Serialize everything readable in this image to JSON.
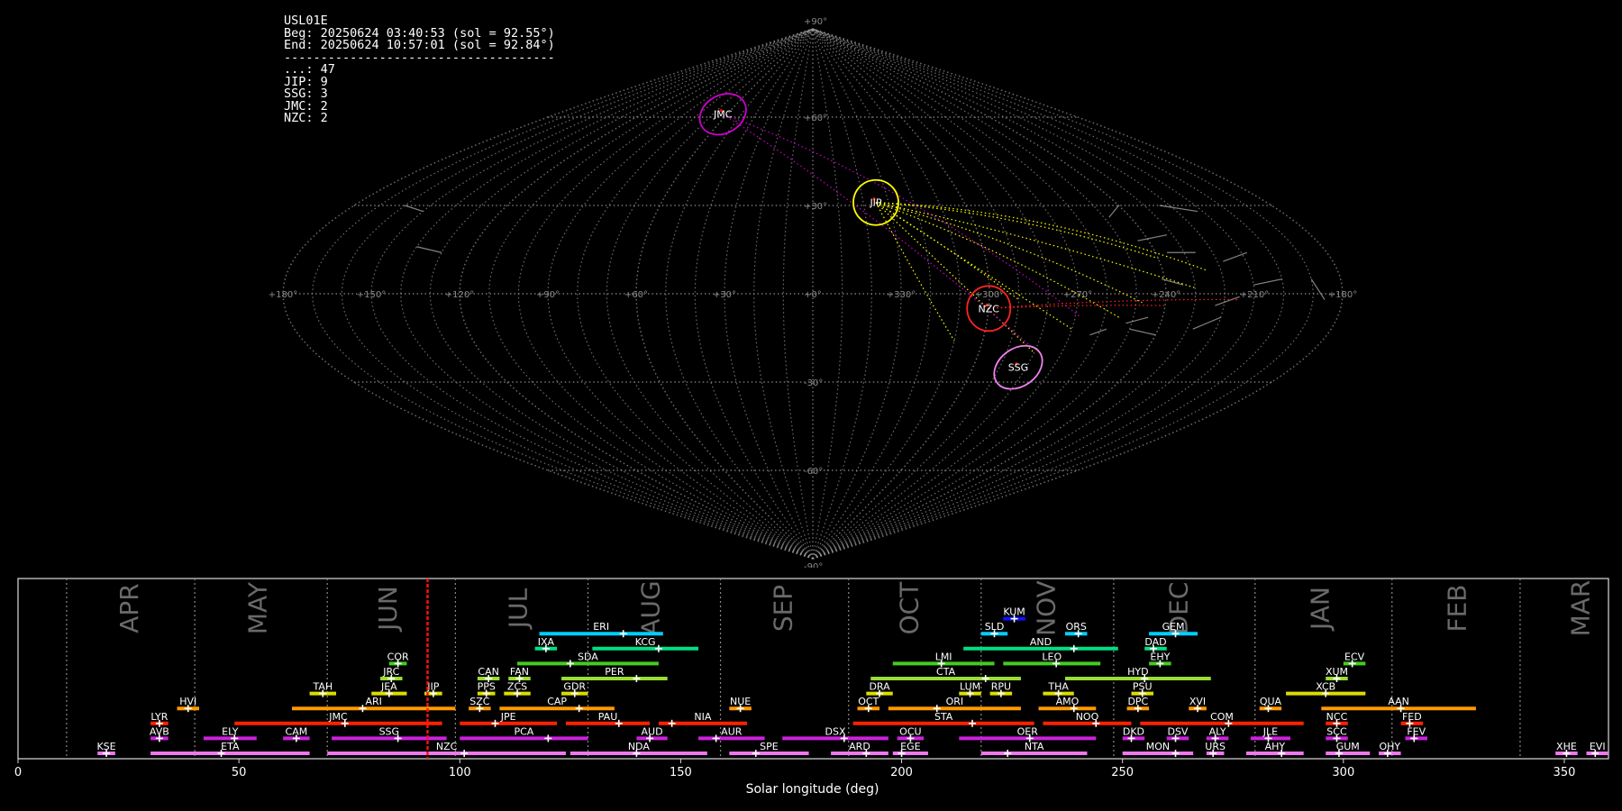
{
  "summary": {
    "station": "USL01E",
    "begin": "Beg: 20250624 03:40:53 (sol = 92.55°)",
    "end": "End: 20250624 10:57:01 (sol = 92.84°)",
    "separator": "-------------------------------------",
    "counts": [
      {
        "code": "...",
        "n": 47,
        "text": "...: 47"
      },
      {
        "code": "JIP",
        "n": 9,
        "text": "JIP: 9"
      },
      {
        "code": "SSG",
        "n": 3,
        "text": "SSG: 3"
      },
      {
        "code": "JMC",
        "n": 2,
        "text": "JMC: 2"
      },
      {
        "code": "NZC",
        "n": 2,
        "text": "NZC: 2"
      }
    ]
  },
  "colors": {
    "background": "#000000",
    "grid": "#9a9a9a",
    "sporadic": "#bbbbbb",
    "solar_marker": "#ff0000",
    "JIP": "#ffff00",
    "SSG": "#ee82ee",
    "JMC": "#cc00cc",
    "NZC": "#ff2222"
  },
  "chart_data": [
    {
      "type": "scatter",
      "projection": "sinusoidal",
      "lon_ticks": [
        "+180°",
        "+150°",
        "+120°",
        "+90°",
        "+60°",
        "+30°",
        "+0°",
        "+330°",
        "+300°",
        "+270°",
        "+240°",
        "+210°",
        "+180°"
      ],
      "lat_ticks": [
        "+90°",
        "+60°",
        "+30°",
        "-30°",
        "-60°",
        "-90°"
      ],
      "radiants": [
        {
          "code": "JMC",
          "lon": 63,
          "lat": 61,
          "color": "#cc00cc"
        },
        {
          "code": "JIP",
          "lon": 335,
          "lat": 31,
          "color": "#ffff00"
        },
        {
          "code": "NZC",
          "lon": 300,
          "lat": -5,
          "color": "#ff2222"
        },
        {
          "code": "SSG",
          "lon": 283,
          "lat": -25,
          "color": "#ee82ee"
        }
      ]
    },
    {
      "type": "timeline",
      "xlabel": "Solar longitude (deg)",
      "xlim": [
        0,
        360
      ],
      "xticks": [
        0,
        50,
        100,
        150,
        200,
        250,
        300,
        350
      ],
      "current_sol": 92.7,
      "months": [
        {
          "name": "APR",
          "start": 11,
          "label_at": 24.5
        },
        {
          "name": "MAY",
          "start": 40,
          "label_at": 53.5
        },
        {
          "name": "JUN",
          "start": 70,
          "label_at": 83
        },
        {
          "name": "JUL",
          "start": 99,
          "label_at": 112.5
        },
        {
          "name": "AUG",
          "start": 129,
          "label_at": 142.5
        },
        {
          "name": "SEP",
          "start": 159,
          "label_at": 172.5
        },
        {
          "name": "OCT",
          "start": 188,
          "label_at": 201
        },
        {
          "name": "NOV",
          "start": 218,
          "label_at": 232
        },
        {
          "name": "DEC",
          "start": 248,
          "label_at": 262
        },
        {
          "name": "JAN",
          "start": 280,
          "label_at": 294
        },
        {
          "name": "FEB",
          "start": 311,
          "label_at": 325
        },
        {
          "name": "MAR",
          "start": 340,
          "label_at": 353
        }
      ],
      "showers": [
        {
          "code": "KUM",
          "start": 223,
          "end": 228,
          "peak": 225.5,
          "row": 10,
          "color": "#1111ff"
        },
        {
          "code": "ERI",
          "start": 118,
          "end": 146,
          "peak": 137,
          "row": 9,
          "color": "#00cfff"
        },
        {
          "code": "SLD",
          "start": 218,
          "end": 224,
          "peak": 221,
          "row": 9,
          "color": "#00cfff"
        },
        {
          "code": "ORS",
          "start": 237,
          "end": 242,
          "peak": 240,
          "row": 9,
          "color": "#00cfff"
        },
        {
          "code": "GEM",
          "start": 256,
          "end": 267,
          "peak": 262,
          "row": 9,
          "color": "#00cfff"
        },
        {
          "code": "IXA",
          "start": 117,
          "end": 122,
          "peak": 119.5,
          "row": 8,
          "color": "#00e080"
        },
        {
          "code": "KCG",
          "start": 130,
          "end": 154,
          "peak": 145,
          "row": 8,
          "color": "#00e080"
        },
        {
          "code": "AND",
          "start": 214,
          "end": 249,
          "peak": 239,
          "row": 8,
          "color": "#00e080"
        },
        {
          "code": "DAD",
          "start": 255,
          "end": 260,
          "peak": 257,
          "row": 8,
          "color": "#00e080"
        },
        {
          "code": "COR",
          "start": 84,
          "end": 88,
          "peak": 86,
          "row": 7,
          "color": "#44cc22"
        },
        {
          "code": "SDA",
          "start": 113,
          "end": 145,
          "peak": 125,
          "row": 7,
          "color": "#44cc22"
        },
        {
          "code": "LMI",
          "start": 198,
          "end": 221,
          "peak": 209,
          "row": 7,
          "color": "#44cc22"
        },
        {
          "code": "LEO",
          "start": 223,
          "end": 245,
          "peak": 235,
          "row": 7,
          "color": "#44cc22"
        },
        {
          "code": "EHY",
          "start": 256,
          "end": 261,
          "peak": 258.5,
          "row": 7,
          "color": "#44cc22"
        },
        {
          "code": "ECV",
          "start": 300,
          "end": 305,
          "peak": 302,
          "row": 7,
          "color": "#44cc22"
        },
        {
          "code": "JRC",
          "start": 82,
          "end": 87,
          "peak": 84.5,
          "row": 6,
          "color": "#99dd33"
        },
        {
          "code": "CAN",
          "start": 104,
          "end": 109,
          "peak": 106.5,
          "row": 6,
          "color": "#99dd33"
        },
        {
          "code": "FAN",
          "start": 111,
          "end": 116,
          "peak": 113.5,
          "row": 6,
          "color": "#99dd33"
        },
        {
          "code": "PER",
          "start": 123,
          "end": 147,
          "peak": 140,
          "row": 6,
          "color": "#99dd33"
        },
        {
          "code": "CTA",
          "start": 193,
          "end": 227,
          "peak": 219,
          "row": 6,
          "color": "#99dd33"
        },
        {
          "code": "HYD",
          "start": 237,
          "end": 270,
          "peak": 255,
          "row": 6,
          "color": "#99dd33"
        },
        {
          "code": "XUM",
          "start": 296,
          "end": 301,
          "peak": 298.5,
          "row": 6,
          "color": "#99dd33"
        },
        {
          "code": "TAH",
          "start": 66,
          "end": 72,
          "peak": 69,
          "row": 5,
          "color": "#dddd00"
        },
        {
          "code": "JEA",
          "start": 80,
          "end": 88,
          "peak": 84,
          "row": 5,
          "color": "#dddd00"
        },
        {
          "code": "JIP",
          "start": 92,
          "end": 96,
          "peak": 94,
          "row": 5,
          "color": "#dddd00"
        },
        {
          "code": "PPS",
          "start": 104,
          "end": 108,
          "peak": 106,
          "row": 5,
          "color": "#dddd00"
        },
        {
          "code": "ZCS",
          "start": 110,
          "end": 116,
          "peak": 113,
          "row": 5,
          "color": "#dddd00"
        },
        {
          "code": "GDR",
          "start": 123,
          "end": 129,
          "peak": 126,
          "row": 5,
          "color": "#dddd00"
        },
        {
          "code": "DRA",
          "start": 192,
          "end": 198,
          "peak": 195,
          "row": 5,
          "color": "#dddd00"
        },
        {
          "code": "LUM",
          "start": 213,
          "end": 218,
          "peak": 215.5,
          "row": 5,
          "color": "#dddd00"
        },
        {
          "code": "RPU",
          "start": 220,
          "end": 225,
          "peak": 222.5,
          "row": 5,
          "color": "#dddd00"
        },
        {
          "code": "THA",
          "start": 232,
          "end": 239,
          "peak": 235.5,
          "row": 5,
          "color": "#dddd00"
        },
        {
          "code": "PSU",
          "start": 252,
          "end": 257,
          "peak": 254.5,
          "row": 5,
          "color": "#dddd00"
        },
        {
          "code": "XCB",
          "start": 287,
          "end": 305,
          "peak": 296,
          "row": 5,
          "color": "#dddd00"
        },
        {
          "code": "HVI",
          "start": 36,
          "end": 41,
          "peak": 38.5,
          "row": 4,
          "color": "#ff9900"
        },
        {
          "code": "ARI",
          "start": 62,
          "end": 99,
          "peak": 78,
          "row": 4,
          "color": "#ff9900"
        },
        {
          "code": "SZC",
          "start": 102,
          "end": 107,
          "peak": 104.5,
          "row": 4,
          "color": "#ff9900"
        },
        {
          "code": "CAP",
          "start": 109,
          "end": 135,
          "peak": 127,
          "row": 4,
          "color": "#ff9900"
        },
        {
          "code": "NUE",
          "start": 161,
          "end": 166,
          "peak": 163.5,
          "row": 4,
          "color": "#ff9900"
        },
        {
          "code": "OCT",
          "start": 190,
          "end": 195,
          "peak": 192.5,
          "row": 4,
          "color": "#ff9900"
        },
        {
          "code": "ORI",
          "start": 197,
          "end": 227,
          "peak": 208,
          "row": 4,
          "color": "#ff9900"
        },
        {
          "code": "AMO",
          "start": 231,
          "end": 244,
          "peak": 239,
          "row": 4,
          "color": "#ff9900"
        },
        {
          "code": "DPC",
          "start": 251,
          "end": 256,
          "peak": 253.5,
          "row": 4,
          "color": "#ff9900"
        },
        {
          "code": "XVI",
          "start": 265,
          "end": 269,
          "peak": 267,
          "row": 4,
          "color": "#ff9900"
        },
        {
          "code": "QUA",
          "start": 281,
          "end": 286,
          "peak": 283,
          "row": 4,
          "color": "#ff9900"
        },
        {
          "code": "AAN",
          "start": 295,
          "end": 330,
          "peak": 313,
          "row": 4,
          "color": "#ff9900"
        },
        {
          "code": "LYR",
          "start": 30,
          "end": 34,
          "peak": 32,
          "row": 3,
          "color": "#ff2200"
        },
        {
          "code": "JMC",
          "start": 49,
          "end": 96,
          "peak": 74,
          "row": 3,
          "color": "#ff2200"
        },
        {
          "code": "JPE",
          "start": 100,
          "end": 122,
          "peak": 108,
          "row": 3,
          "color": "#ff2200"
        },
        {
          "code": "PAU",
          "start": 124,
          "end": 143,
          "peak": 136,
          "row": 3,
          "color": "#ff2200"
        },
        {
          "code": "NIA",
          "start": 145,
          "end": 165,
          "peak": 148,
          "row": 3,
          "color": "#ff2200"
        },
        {
          "code": "STA",
          "start": 189,
          "end": 230,
          "peak": 216,
          "row": 3,
          "color": "#ff2200"
        },
        {
          "code": "NOO",
          "start": 232,
          "end": 252,
          "peak": 244,
          "row": 3,
          "color": "#ff2200"
        },
        {
          "code": "COM",
          "start": 254,
          "end": 291,
          "peak": 274,
          "row": 3,
          "color": "#ff2200"
        },
        {
          "code": "NCC",
          "start": 296,
          "end": 301,
          "peak": 298.5,
          "row": 3,
          "color": "#ff2200"
        },
        {
          "code": "FED",
          "start": 313,
          "end": 318,
          "peak": 315,
          "row": 3,
          "color": "#ff2200"
        },
        {
          "code": "AVB",
          "start": 30,
          "end": 34,
          "peak": 32,
          "row": 2,
          "color": "#cc22dd"
        },
        {
          "code": "ELY",
          "start": 42,
          "end": 54,
          "peak": 49,
          "row": 2,
          "color": "#cc22dd"
        },
        {
          "code": "CAM",
          "start": 60,
          "end": 66,
          "peak": 63,
          "row": 2,
          "color": "#cc22dd"
        },
        {
          "code": "SSG",
          "start": 71,
          "end": 97,
          "peak": 86,
          "row": 2,
          "color": "#cc22dd"
        },
        {
          "code": "PCA",
          "start": 100,
          "end": 129,
          "peak": 120,
          "row": 2,
          "color": "#cc22dd"
        },
        {
          "code": "AUD",
          "start": 140,
          "end": 147,
          "peak": 143,
          "row": 2,
          "color": "#cc22dd"
        },
        {
          "code": "AUR",
          "start": 154,
          "end": 169,
          "peak": 158,
          "row": 2,
          "color": "#cc22dd"
        },
        {
          "code": "DSX",
          "start": 173,
          "end": 197,
          "peak": 187,
          "row": 2,
          "color": "#cc22dd"
        },
        {
          "code": "OCU",
          "start": 199,
          "end": 205,
          "peak": 202,
          "row": 2,
          "color": "#cc22dd"
        },
        {
          "code": "OER",
          "start": 213,
          "end": 244,
          "peak": 229,
          "row": 2,
          "color": "#cc22dd"
        },
        {
          "code": "DKD",
          "start": 250,
          "end": 255,
          "peak": 252,
          "row": 2,
          "color": "#cc22dd"
        },
        {
          "code": "DSV",
          "start": 260,
          "end": 265,
          "peak": 262,
          "row": 2,
          "color": "#cc22dd"
        },
        {
          "code": "ALY",
          "start": 269,
          "end": 274,
          "peak": 271,
          "row": 2,
          "color": "#cc22dd"
        },
        {
          "code": "JLE",
          "start": 279,
          "end": 288,
          "peak": 283,
          "row": 2,
          "color": "#cc22dd"
        },
        {
          "code": "SCC",
          "start": 296,
          "end": 301,
          "peak": 298.5,
          "row": 2,
          "color": "#cc22dd"
        },
        {
          "code": "FEV",
          "start": 314,
          "end": 319,
          "peak": 316,
          "row": 2,
          "color": "#cc22dd"
        },
        {
          "code": "KSE",
          "start": 18,
          "end": 22,
          "peak": 20,
          "row": 1,
          "color": "#ee77ee"
        },
        {
          "code": "ETA",
          "start": 30,
          "end": 66,
          "peak": 46,
          "row": 1,
          "color": "#ee77ee"
        },
        {
          "code": "NZC",
          "start": 70,
          "end": 124,
          "peak": 101,
          "row": 1,
          "color": "#ee77ee"
        },
        {
          "code": "NDA",
          "start": 125,
          "end": 156,
          "peak": 140,
          "row": 1,
          "color": "#ee77ee"
        },
        {
          "code": "SPE",
          "start": 161,
          "end": 179,
          "peak": 167,
          "row": 1,
          "color": "#ee77ee"
        },
        {
          "code": "ARD",
          "start": 184,
          "end": 197,
          "peak": 192,
          "row": 1,
          "color": "#ee77ee"
        },
        {
          "code": "EGE",
          "start": 198,
          "end": 206,
          "peak": 200,
          "row": 1,
          "color": "#ee77ee"
        },
        {
          "code": "NTA",
          "start": 218,
          "end": 242,
          "peak": 224,
          "row": 1,
          "color": "#ee77ee"
        },
        {
          "code": "MON",
          "start": 250,
          "end": 266,
          "peak": 262,
          "row": 1,
          "color": "#ee77ee"
        },
        {
          "code": "URS",
          "start": 269,
          "end": 273,
          "peak": 270.5,
          "row": 1,
          "color": "#ee77ee"
        },
        {
          "code": "AHY",
          "start": 278,
          "end": 291,
          "peak": 286,
          "row": 1,
          "color": "#ee77ee"
        },
        {
          "code": "GUM",
          "start": 296,
          "end": 306,
          "peak": 299,
          "row": 1,
          "color": "#ee77ee"
        },
        {
          "code": "OHY",
          "start": 308,
          "end": 313,
          "peak": 310,
          "row": 1,
          "color": "#ee77ee"
        },
        {
          "code": "XHE",
          "start": 348,
          "end": 353,
          "peak": 350.5,
          "row": 1,
          "color": "#ee77ee"
        },
        {
          "code": "EVI",
          "start": 355,
          "end": 360,
          "peak": 357,
          "row": 1,
          "color": "#ee77ee"
        }
      ]
    }
  ]
}
